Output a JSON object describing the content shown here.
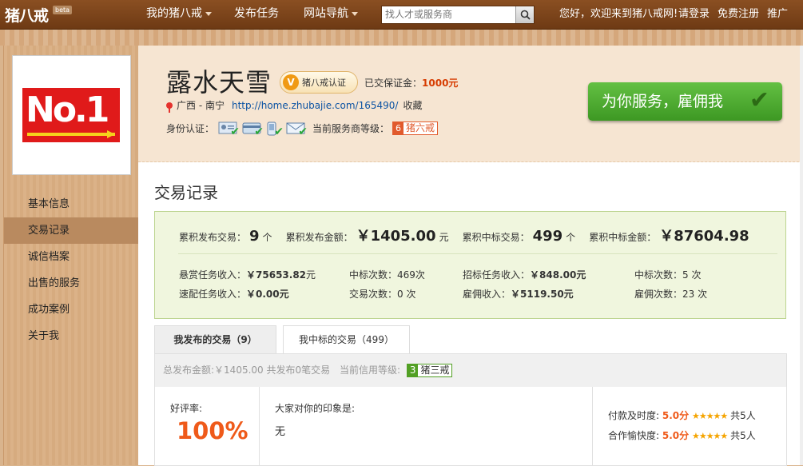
{
  "topbar": {
    "logo": "猪八戒",
    "beta": "beta",
    "nav": [
      {
        "label": "我的猪八戒",
        "dropdown": true
      },
      {
        "label": "发布任务",
        "dropdown": false
      },
      {
        "label": "网站导航",
        "dropdown": true
      }
    ],
    "search_placeholder": "找人才或服务商",
    "greeting": "您好，欢迎来到猪八戒网!",
    "login": "请登录",
    "register": "免费注册",
    "promote": "推广"
  },
  "sidebar": {
    "avatar_text": "No.1",
    "items": [
      {
        "label": "基本信息",
        "active": false
      },
      {
        "label": "交易记录",
        "active": true
      },
      {
        "label": "诚信档案",
        "active": false
      },
      {
        "label": "出售的服务",
        "active": false
      },
      {
        "label": "成功案例",
        "active": false
      },
      {
        "label": "关于我",
        "active": false
      }
    ]
  },
  "profile": {
    "name": "露水天雪",
    "badge_icon": "V",
    "badge": "猪八戒认证",
    "deposit_label": "已交保证金：",
    "deposit_value": "1000元",
    "location": "广西 - 南宁",
    "homepage": "http://home.zhubajie.com/165490/",
    "collect": "收藏",
    "verify_label": "身份认证：",
    "level_label": "当前服务商等级：",
    "level_num": "6",
    "level_name": "猪六戒",
    "hire_button": "为你服务，雇佣我"
  },
  "section_title": "交易记录",
  "stats": {
    "row1": [
      {
        "label": "累积发布交易：",
        "value": "9",
        "unit": "个"
      },
      {
        "label": "累积发布金额：",
        "value": "￥1405.00",
        "unit": "元"
      },
      {
        "label": "累积中标交易：",
        "value": "499",
        "unit": "个"
      },
      {
        "label": "累积中标金额：",
        "value": "￥87604.98",
        "unit": ""
      }
    ],
    "reward_income_label": "悬赏任务收入：",
    "reward_income_value": "￥75653.82",
    "reward_income_unit": "元",
    "win_count_label": "中标次数：",
    "win_count_value": "469次",
    "bid_income_label": "招标任务收入：",
    "bid_income_value": "￥848.00元",
    "bid_win_label": "中标次数：",
    "bid_win_value": "5 次",
    "quick_income_label": "速配任务收入：",
    "quick_income_value": "￥0.00元",
    "trade_count_label": "交易次数：",
    "trade_count_value": "0 次",
    "hire_income_label": "雇佣收入：",
    "hire_income_value": "￥5119.50元",
    "hire_count_label": "雇佣次数：",
    "hire_count_value": "23 次"
  },
  "tabs": [
    {
      "label": "我发布的交易（9）",
      "active": true
    },
    {
      "label": "我中标的交易（499）",
      "active": false
    }
  ],
  "summary": {
    "text": "总发布金额:￥1405.00 共发布0笔交易",
    "credit_label": "当前信用等级:",
    "credit_num": "3",
    "credit_name": "猪三戒"
  },
  "review": {
    "rate_label": "好评率:",
    "rate_value": "100%",
    "impression_label": "大家对你的印象是:",
    "impression_value": "无",
    "payment_label": "付款及时度:",
    "payment_score": "5.0分",
    "payment_count": "共5人",
    "cooperation_label": "合作愉快度:",
    "cooperation_score": "5.0分",
    "cooperation_count": "共5人",
    "stars": "★★★★★"
  },
  "colors": {
    "topbar": "#7a4419",
    "accent_orange": "#e15a2c",
    "hire_green": "#4aa82c",
    "stats_bg": "#f0f6de"
  }
}
